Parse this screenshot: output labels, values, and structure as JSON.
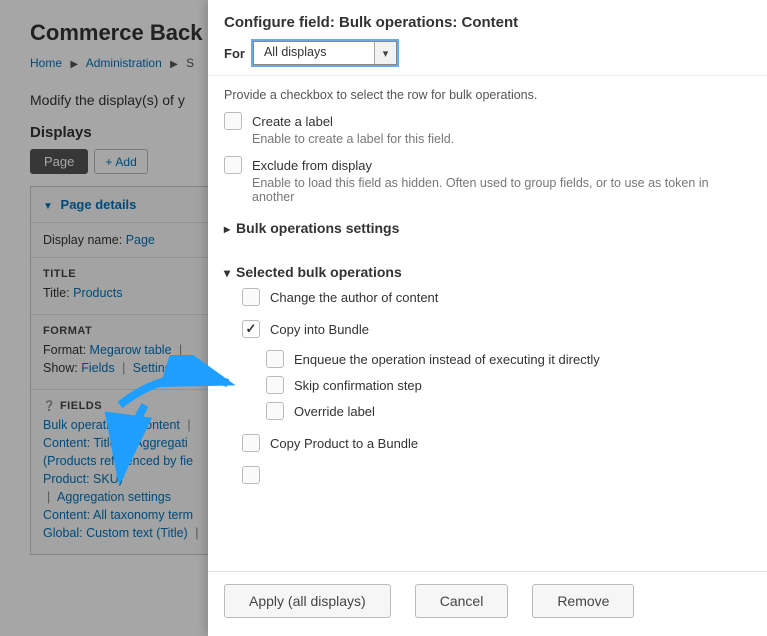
{
  "page": {
    "title_visible": "Commerce Back",
    "breadcrumbs": {
      "home": "Home",
      "admin": "Administration",
      "third_initial": "S"
    },
    "modify_visible": "Modify the display(s) of y",
    "displays_heading": "Displays",
    "tabs": {
      "page": "Page",
      "add": "Add"
    },
    "details": {
      "header": "Page details",
      "display_name_label": "Display name:",
      "display_name_value": "Page",
      "title_section": "TITLE",
      "title_label": "Title:",
      "title_value": "Products",
      "format_section": "FORMAT",
      "format_label": "Format:",
      "format_value": "Megarow table",
      "show_label": "Show:",
      "show_value": "Fields",
      "show_settings": "Settings",
      "fields_section": "FIELDS",
      "fields": {
        "bulk_ops": "Bulk operations: Content",
        "content_title": "Content: Title",
        "agg_partial": "Aggregati",
        "products_ref": "(Products referenced by fie",
        "product_sku": "Product: SKU)",
        "agg_settings": "Aggregation settings",
        "all_tax": "Content: All taxonomy term",
        "global_custom": "Global: Custom text (Title)"
      }
    }
  },
  "modal": {
    "title": "Configure field: Bulk operations: Content",
    "for_label": "For",
    "for_value": "All displays",
    "help1": "Provide a checkbox to select the row for bulk operations.",
    "create_label": "Create a label",
    "create_label_help": "Enable to create a label for this field.",
    "exclude": "Exclude from display",
    "exclude_help": "Enable to load this field as hidden. Often used to group fields, or to use as token in another",
    "bulk_settings": "Bulk operations settings",
    "selected_heading": "Selected bulk operations",
    "ops": {
      "change_author": "Change the author of content",
      "copy_bundle": "Copy into Bundle",
      "enqueue": "Enqueue the operation instead of executing it directly",
      "skip": "Skip confirmation step",
      "override": "Override label",
      "copy_product": "Copy Product to a Bundle"
    },
    "buttons": {
      "apply": "Apply (all displays)",
      "cancel": "Cancel",
      "remove": "Remove"
    }
  }
}
